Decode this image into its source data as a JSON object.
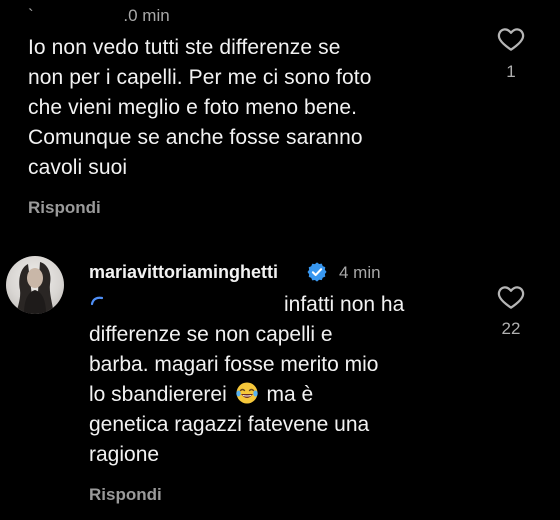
{
  "comments": [
    {
      "meta": "`                   .0 min",
      "lines": [
        "Io non vedo tutti ste differenze se",
        "non per i capelli. Per me ci sono foto",
        "che vieni meglio e foto meno bene.",
        "Comunque se anche fosse saranno",
        "cavoli suoi"
      ],
      "reply_label": "Rispondi",
      "like_icon": "heart-outline-icon",
      "like_count": "1"
    },
    {
      "username": "mariavittoriaminghetti",
      "verified_icon": "verified-badge-icon",
      "time": "4 min",
      "lines": [
        "infatti non ha",
        "differenze se non capelli e",
        "barba. magari fosse merito mio",
        "lo sbandiererei",
        "ma è",
        "genetica ragazzi fatevene una",
        "ragione"
      ],
      "emoji": "face-with-tears-of-joy-icon",
      "reply_label": "Rispondi",
      "like_icon": "heart-outline-icon",
      "like_count": "22"
    }
  ],
  "colors": {
    "background": "#000000",
    "text": "#f2f2f2",
    "muted": "#a8a8a8",
    "verified": "#3897f0"
  }
}
